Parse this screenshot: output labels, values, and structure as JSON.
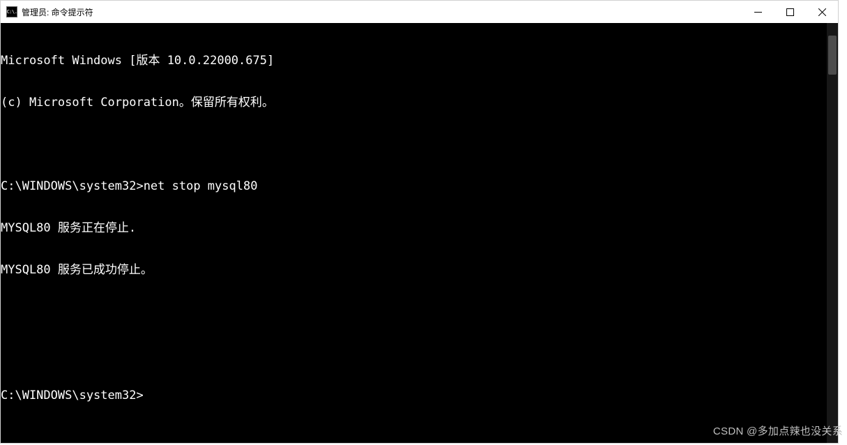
{
  "titleBar": {
    "iconLabel": "C:\\.",
    "title": "管理员: 命令提示符"
  },
  "terminal": {
    "lines": [
      "Microsoft Windows [版本 10.0.22000.675]",
      "(c) Microsoft Corporation。保留所有权利。",
      "",
      "C:\\WINDOWS\\system32>net stop mysql80",
      "MYSQL80 服务正在停止.",
      "MYSQL80 服务已成功停止。",
      "",
      "",
      "C:\\WINDOWS\\system32>"
    ]
  },
  "watermark": "CSDN @多加点辣也没关系"
}
